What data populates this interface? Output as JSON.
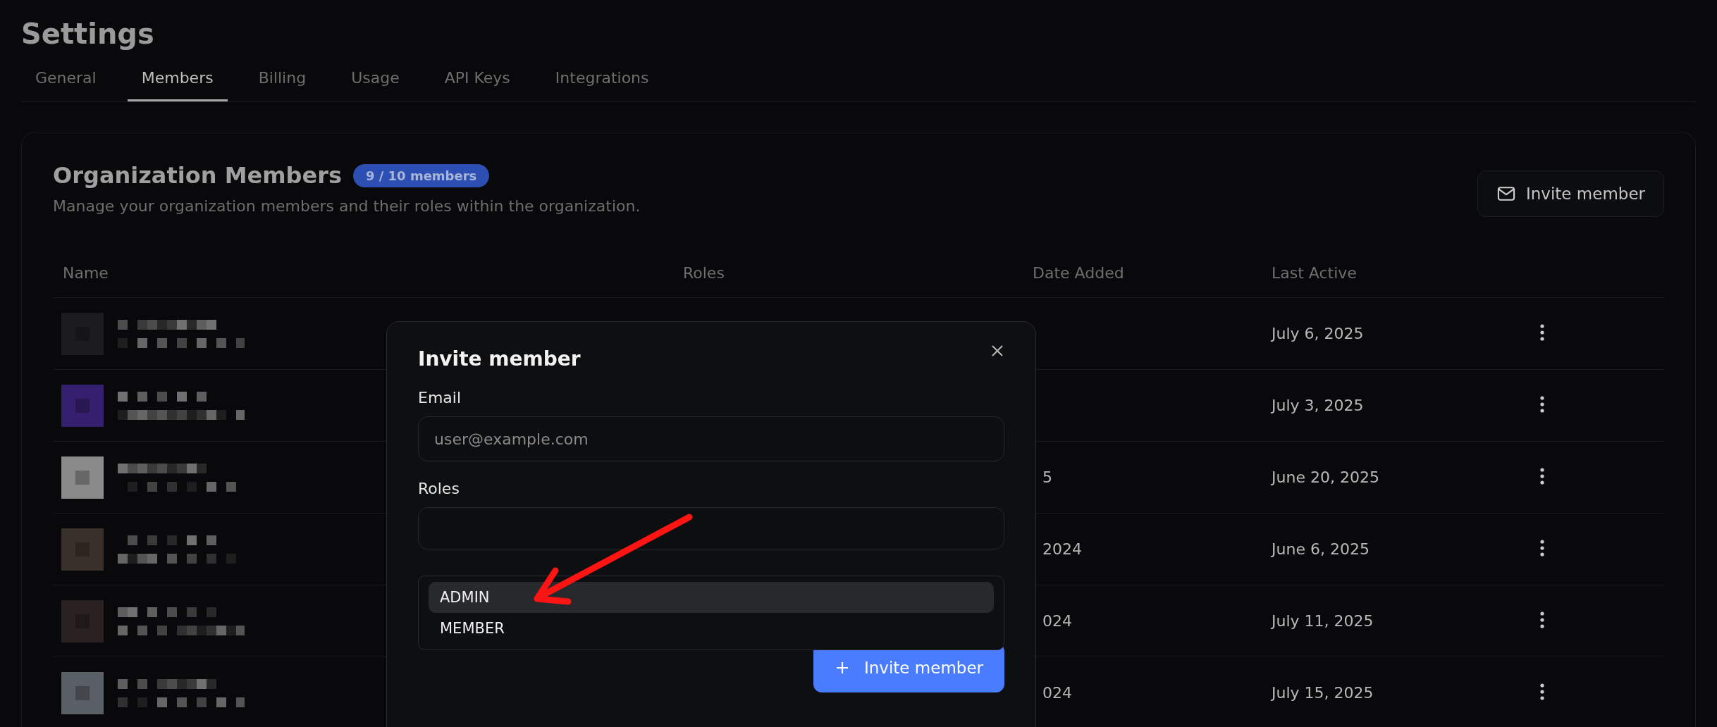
{
  "page_title": "Settings",
  "tabs": [
    {
      "label": "General",
      "selected": false
    },
    {
      "label": "Members",
      "selected": true
    },
    {
      "label": "Billing",
      "selected": false
    },
    {
      "label": "Usage",
      "selected": false
    },
    {
      "label": "API Keys",
      "selected": false
    },
    {
      "label": "Integrations",
      "selected": false
    }
  ],
  "card": {
    "title": "Organization Members",
    "badge": "9 / 10 members",
    "description": "Manage your organization members and their roles within the organization.",
    "invite_button": "Invite member"
  },
  "table": {
    "columns": [
      "Name",
      "Roles",
      "Date Added",
      "Last Active"
    ],
    "rows": [
      {
        "color": "#1c1c1f",
        "last_active": "July 6, 2025"
      },
      {
        "color": "#34206e",
        "last_active": "July 3, 2025"
      },
      {
        "color": "#8a8a8a",
        "date_added": "5",
        "last_active": "June 20, 2025"
      },
      {
        "color": "#3a302a",
        "date_added": "2024",
        "last_active": "June 6, 2025"
      },
      {
        "color": "#2a2222",
        "date_added": "024",
        "last_active": "July 11, 2025"
      },
      {
        "color": "#5a5f66",
        "date_added": "024",
        "last_active": "July 15, 2025"
      }
    ]
  },
  "dialog": {
    "title": "Invite member",
    "email_label": "Email",
    "email_placeholder": "user@example.com",
    "roles_label": "Roles",
    "submit_button": "Invite member",
    "role_options": [
      {
        "label": "ADMIN",
        "selected": true
      },
      {
        "label": "MEMBER",
        "selected": false
      }
    ]
  }
}
